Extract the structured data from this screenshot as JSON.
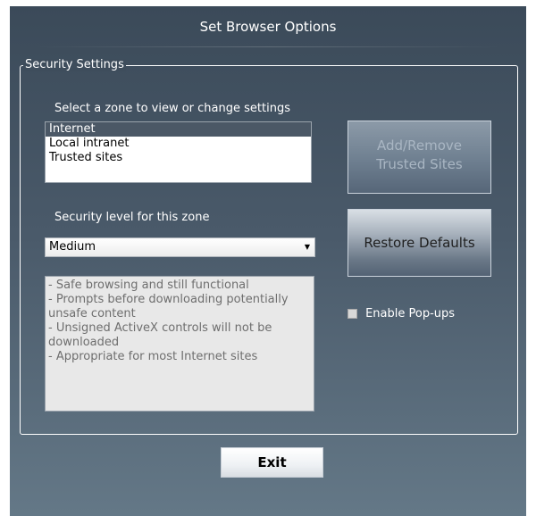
{
  "window": {
    "title": "Set Browser Options"
  },
  "security_group": {
    "legend": "Security Settings",
    "zone_prompt": "Select a zone to view or change settings",
    "zones": [
      {
        "label": "Internet",
        "selected": true
      },
      {
        "label": "Local intranet",
        "selected": false
      },
      {
        "label": "Trusted sites",
        "selected": false
      }
    ],
    "level_label": "Security level for this zone",
    "level_selected": "Medium",
    "description_lines": [
      "- Safe browsing and still functional",
      "- Prompts before downloading potentially unsafe content",
      "- Unsigned ActiveX controls will not be downloaded",
      "- Appropriate for most Internet sites"
    ]
  },
  "buttons": {
    "add_remove_line1": "Add/Remove",
    "add_remove_line2": "Trusted Sites",
    "restore": "Restore Defaults",
    "exit": "Exit"
  },
  "popups": {
    "label": "Enable Pop-ups",
    "checked": false
  },
  "colors": {
    "dialog_top": "#3b4a59",
    "dialog_bottom": "#647887",
    "list_selection": "#4b5866",
    "disabled_text": "#a9b6c3"
  }
}
